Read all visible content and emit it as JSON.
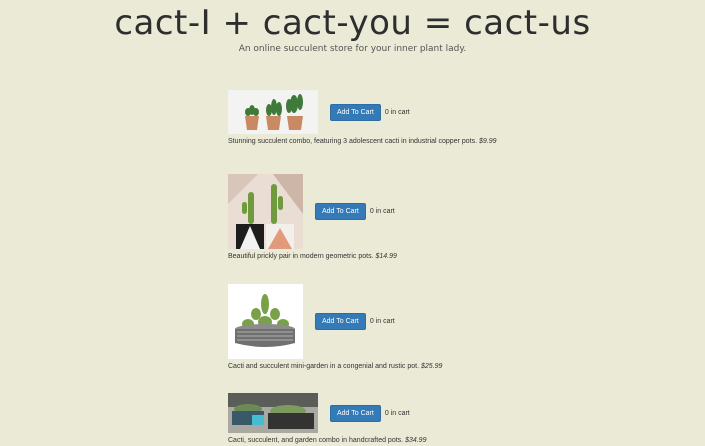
{
  "site": {
    "title": "cact-I + cact-you = cact-us",
    "tagline": "An online succulent store for your inner plant lady."
  },
  "products": [
    {
      "description": "Stunning succulent combo, featuring 3 adolescent cacti in industrial copper pots.",
      "price": "$9.99",
      "button_label": "Add To Cart",
      "cart_count": "0 in cart"
    },
    {
      "description": "Beautiful prickly pair in modern geometric pots.",
      "price": "$14.99",
      "button_label": "Add To Cart",
      "cart_count": "0 in cart"
    },
    {
      "description": "Cacti and succulent mini-garden in a congenial and rustic pot.",
      "price": "$25.99",
      "button_label": "Add To Cart",
      "cart_count": "0 in cart"
    },
    {
      "description": "Cacti, succulent, and garden combo in handcrafted pots.",
      "price": "$34.99",
      "button_label": "Add To Cart",
      "cart_count": "0 in cart"
    }
  ]
}
